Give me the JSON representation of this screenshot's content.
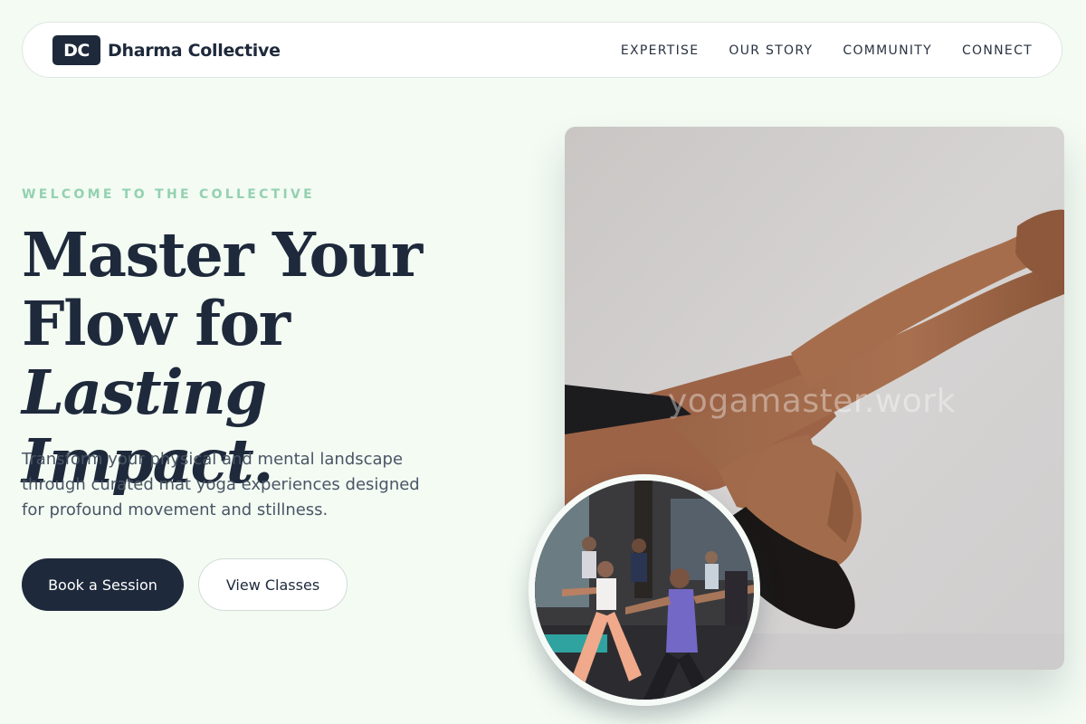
{
  "brand": {
    "mark": "DC",
    "name": "Dharma Collective"
  },
  "nav": {
    "links": [
      "EXPERTISE",
      "OUR STORY",
      "COMMUNITY",
      "CONNECT"
    ]
  },
  "hero": {
    "eyebrow": "WELCOME TO THE COLLECTIVE",
    "headline_line1": "Master Your",
    "headline_line2a": "Flow for ",
    "headline_line2b": "Lasting",
    "headline_line3": "Impact.",
    "lede": "Transform your physical and mental landscape through curated mat yoga experiences designed for profound movement and stillness.",
    "primary_cta": "Book a Session",
    "secondary_cta": "View Classes"
  },
  "media": {
    "main_photo_watermark": "yogamaster.work"
  },
  "colors": {
    "background": "#f3fbf3",
    "navy": "#1e293b",
    "eyebrow_mint": "#93d1b0"
  }
}
